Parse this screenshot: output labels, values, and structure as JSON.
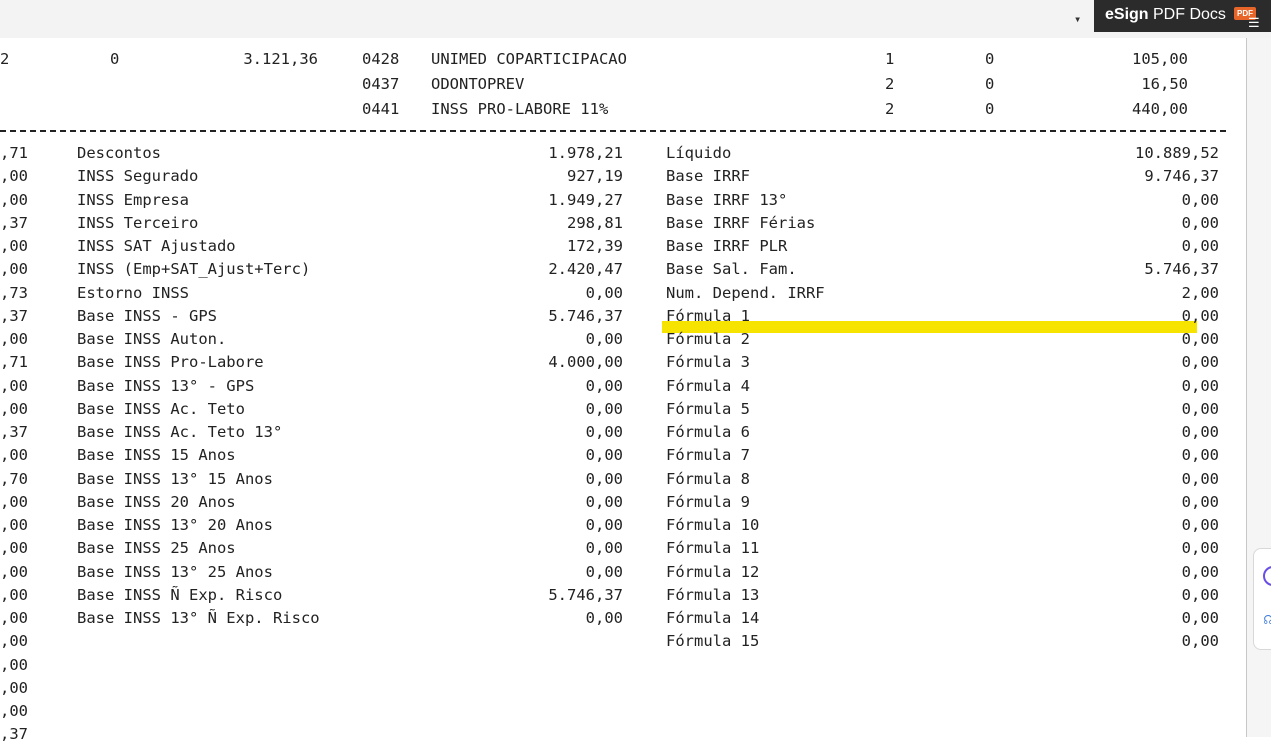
{
  "toolbar": {
    "caret_glyph": "▾",
    "esign_brand": "eSign",
    "esign_suffix": " PDF Docs",
    "pdf_badge": "PDF",
    "menu_glyph": "☰"
  },
  "top_rows": [
    {
      "col1": "2",
      "col2": "0",
      "col3": "3.121,36",
      "code": "0428",
      "desc": "UNIMED COPARTICIPACAO",
      "qty": "1",
      "z": "0",
      "value": "105,00"
    },
    {
      "col1": "",
      "col2": "",
      "col3": "",
      "code": "0437",
      "desc": "ODONTOPREV",
      "qty": "2",
      "z": "0",
      "value": "16,50"
    },
    {
      "col1": "",
      "col2": "",
      "col3": "",
      "code": "0441",
      "desc": "INSS PRO-LABORE 11%",
      "qty": "2",
      "z": "0",
      "value": "440,00"
    }
  ],
  "left_partial_col": [
    ",71",
    ",00",
    ",00",
    ",37",
    ",00",
    ",00",
    ",73",
    ",37",
    ",00",
    ",71",
    ",00",
    ",00",
    ",37",
    ",00",
    ",70",
    ",00",
    ",00",
    ",00",
    ",00",
    ",00",
    ",00",
    ",00",
    ",00",
    ",00",
    ",00",
    ",37"
  ],
  "middle_col": [
    {
      "label": "Descontos",
      "value": "1.978,21"
    },
    {
      "label": "INSS Segurado",
      "value": "927,19"
    },
    {
      "label": "INSS Empresa",
      "value": "1.949,27"
    },
    {
      "label": "INSS Terceiro",
      "value": "298,81"
    },
    {
      "label": "INSS SAT Ajustado",
      "value": "172,39"
    },
    {
      "label": "INSS (Emp+SAT_Ajust+Terc)",
      "value": "2.420,47"
    },
    {
      "label": "Estorno INSS",
      "value": "0,00"
    },
    {
      "label": "Base INSS - GPS",
      "value": "5.746,37"
    },
    {
      "label": "Base INSS Auton.",
      "value": "0,00"
    },
    {
      "label": "Base INSS Pro-Labore",
      "value": "4.000,00"
    },
    {
      "label": "Base INSS 13° - GPS",
      "value": "0,00"
    },
    {
      "label": "Base INSS Ac. Teto",
      "value": "0,00"
    },
    {
      "label": "Base INSS Ac. Teto 13°",
      "value": "0,00"
    },
    {
      "label": "Base INSS 15 Anos",
      "value": "0,00"
    },
    {
      "label": "Base INSS 13° 15 Anos",
      "value": "0,00"
    },
    {
      "label": "Base INSS 20 Anos",
      "value": "0,00"
    },
    {
      "label": "Base INSS 13° 20 Anos",
      "value": "0,00"
    },
    {
      "label": "Base INSS 25 Anos",
      "value": "0,00"
    },
    {
      "label": "Base INSS 13° 25 Anos",
      "value": "0,00"
    },
    {
      "label": "Base INSS Ñ Exp. Risco",
      "value": "5.746,37"
    },
    {
      "label": "Base INSS 13° Ñ Exp. Risco",
      "value": "0,00"
    }
  ],
  "right_col": [
    {
      "label": "Líquido",
      "value": "10.889,52"
    },
    {
      "label": "Base IRRF",
      "value": "9.746,37"
    },
    {
      "label": "Base IRRF 13°",
      "value": "0,00"
    },
    {
      "label": "Base IRRF Férias",
      "value": "0,00"
    },
    {
      "label": "Base IRRF PLR",
      "value": "0,00"
    },
    {
      "label": "Base Sal. Fam.",
      "value": "5.746,37"
    },
    {
      "label": "Num. Depend. IRRF",
      "value": "2,00"
    },
    {
      "label": "Fórmula 1",
      "value": "0,00"
    },
    {
      "label": "Fórmula 2",
      "value": "0,00"
    },
    {
      "label": "Fórmula 3",
      "value": "0,00"
    },
    {
      "label": "Fórmula 4",
      "value": "0,00"
    },
    {
      "label": "Fórmula 5",
      "value": "0,00"
    },
    {
      "label": "Fórmula 6",
      "value": "0,00"
    },
    {
      "label": "Fórmula 7",
      "value": "0,00"
    },
    {
      "label": "Fórmula 8",
      "value": "0,00"
    },
    {
      "label": "Fórmula 9",
      "value": "0,00"
    },
    {
      "label": "Fórmula 10",
      "value": "0,00"
    },
    {
      "label": "Fórmula 11",
      "value": "0,00"
    },
    {
      "label": "Fórmula 12",
      "value": "0,00"
    },
    {
      "label": "Fórmula 13",
      "value": "0,00"
    },
    {
      "label": "Fórmula 14",
      "value": "0,00"
    },
    {
      "label": "Fórmula 15",
      "value": "0,00"
    }
  ],
  "colors": {
    "highlight": "#f7e300",
    "esign_bg": "#2b2b2b",
    "pdf_badge": "#e8652a"
  }
}
